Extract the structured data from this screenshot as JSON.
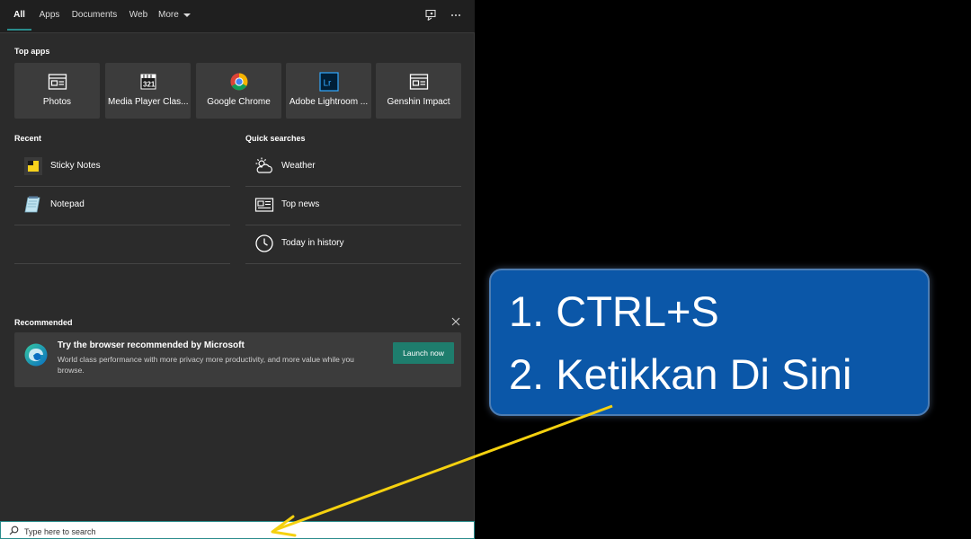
{
  "tabs": [
    {
      "label": "All",
      "active": true
    },
    {
      "label": "Apps"
    },
    {
      "label": "Documents"
    },
    {
      "label": "Web"
    },
    {
      "label": "More"
    }
  ],
  "top_apps": {
    "title": "Top apps",
    "items": [
      {
        "label": "Photos",
        "icon": "photos-icon"
      },
      {
        "label": "Media Player Clas...",
        "icon": "media-player-icon"
      },
      {
        "label": "Google Chrome",
        "icon": "chrome-icon"
      },
      {
        "label": "Adobe Lightroom ...",
        "icon": "lightroom-icon",
        "icon_text": "Lr"
      },
      {
        "label": "Genshin Impact",
        "icon": "app-window-icon"
      }
    ]
  },
  "recent": {
    "title": "Recent",
    "items": [
      {
        "label": "Sticky Notes",
        "icon": "sticky-notes-icon"
      },
      {
        "label": "Notepad",
        "icon": "notepad-icon"
      }
    ]
  },
  "quick_searches": {
    "title": "Quick searches",
    "items": [
      {
        "label": "Weather",
        "icon": "weather-icon"
      },
      {
        "label": "Top news",
        "icon": "news-icon"
      },
      {
        "label": "Today in history",
        "icon": "clock-icon"
      }
    ]
  },
  "recommended": {
    "title": "Recommended",
    "card_title": "Try the browser recommended by Microsoft",
    "card_desc": "World class performance with more privacy more productivity, and more value while you browse.",
    "button_label": "Launch now"
  },
  "search": {
    "placeholder": "Type here to search"
  },
  "callout": {
    "line1": "1. CTRL+S",
    "line2": "2. Ketikkan Di Sini"
  },
  "colors": {
    "accent": "#2a8c8c",
    "launch_button": "#1e7d6d",
    "callout_bg": "#0b57a8",
    "arrow": "#f5d10f"
  }
}
